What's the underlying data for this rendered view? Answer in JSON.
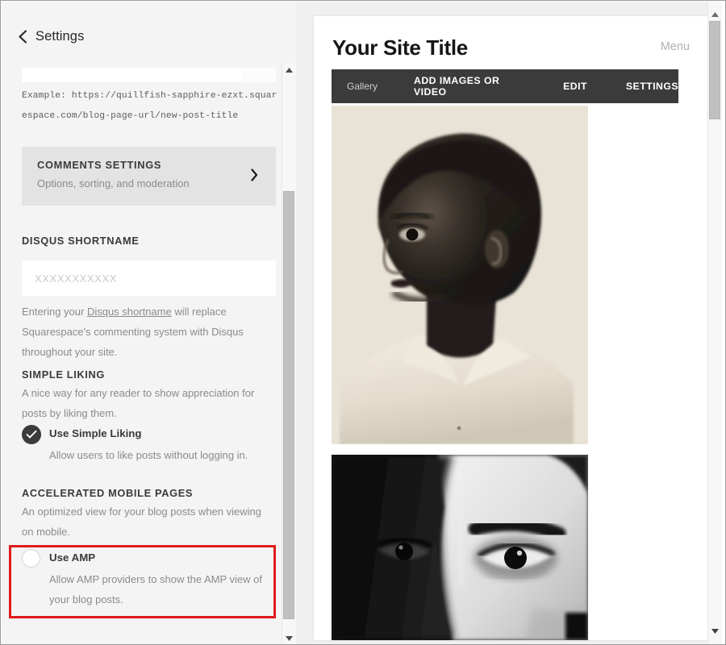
{
  "settings_panel": {
    "header": {
      "back_icon": "chevron-left-icon",
      "title": "Settings"
    },
    "url_field": {
      "value": "",
      "placeholder": ""
    },
    "example_text": "Example: https://quillfish-sapphire-ezxt.squarespace.com/blog-page-url/new-post-title",
    "comments_settings": {
      "title": "COMMENTS SETTINGS",
      "subtitle": "Options, sorting, and moderation",
      "arrow_icon": "chevron-right-icon"
    },
    "disqus": {
      "heading": "DISQUS SHORTNAME",
      "input_value": "",
      "input_placeholder": "XXXXXXXXXXX",
      "description_part1": "Entering your ",
      "description_link": "Disqus shortname",
      "description_part2": " will replace Squarespace's commenting system with Disqus throughout your site."
    },
    "simple_liking": {
      "heading": "SIMPLE LIKING",
      "description": "A nice way for any reader to show appreciation for posts by liking them.",
      "option_label": "Use Simple Liking",
      "option_desc": "Allow users to like posts without logging in.",
      "checked": true,
      "check_icon": "checkmark-icon"
    },
    "amp": {
      "heading": "ACCELERATED MOBILE PAGES",
      "description": "An optimized view for your blog posts when viewing on mobile.",
      "option_label": "Use AMP",
      "option_desc": "Allow AMP providers to show the AMP view of your blog posts.",
      "checked": false,
      "highlight_color": "#e01a1a"
    },
    "scrollbar": {
      "up_icon": "scroll-up-arrow-icon",
      "down_icon": "scroll-down-arrow-icon"
    }
  },
  "preview": {
    "drag_handle": "drag-handle",
    "site_title": "Your Site Title",
    "menu_label": "Menu",
    "editbar": {
      "gallery_label": "Gallery",
      "add_label": "ADD IMAGES OR VIDEO",
      "edit_label": "EDIT",
      "settings_label": "SETTINGS",
      "background_color": "#3b3b3b"
    },
    "images": [
      {
        "name": "portrait-photo-sepia"
      },
      {
        "name": "closeup-eyes-photo-bw"
      }
    ],
    "scrollbar": {
      "up_icon": "scroll-up-arrow-icon",
      "down_icon": "scroll-down-arrow-icon"
    }
  }
}
